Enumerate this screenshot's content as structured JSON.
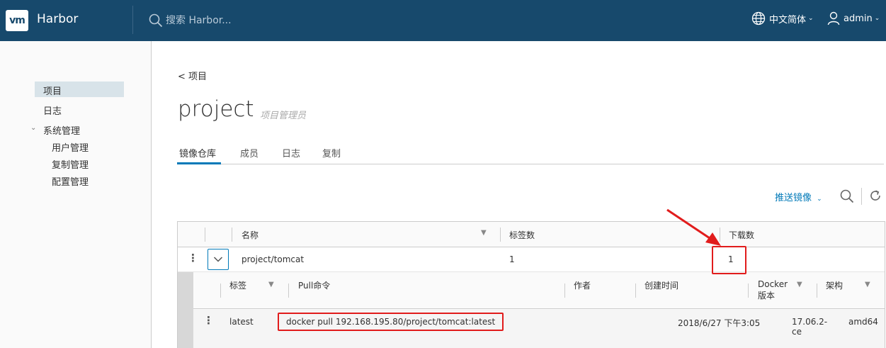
{
  "header": {
    "logo_text": "vm",
    "brand": "Harbor",
    "search_placeholder": "搜索 Harbor...",
    "language": "中文简体",
    "user": "admin"
  },
  "sidebar": {
    "items": [
      {
        "label": "项目",
        "active": true
      },
      {
        "label": "日志"
      },
      {
        "label": "系统管理",
        "children": [
          "用户管理",
          "复制管理",
          "配置管理"
        ]
      }
    ]
  },
  "main": {
    "back_link": "< 项目",
    "title": "project",
    "role": "项目管理员",
    "tabs": [
      "镜像仓库",
      "成员",
      "日志",
      "复制"
    ],
    "push_button": "推送镜像"
  },
  "repo_table": {
    "columns": [
      "名称",
      "标签数",
      "下载数"
    ],
    "rows": [
      {
        "name": "project/tomcat",
        "tags": "1",
        "pulls": "1"
      }
    ]
  },
  "tag_table": {
    "columns": [
      "标签",
      "Pull命令",
      "作者",
      "创建时间",
      "Docker",
      "版本",
      "架构"
    ],
    "rows": [
      {
        "tag": "latest",
        "pull_command": "docker pull 192.168.195.80/project/tomcat:latest",
        "author": "",
        "created": "2018/6/27 下午3:05",
        "docker_version_1": "17.06.2-",
        "docker_version_2": "ce",
        "arch": "amd64"
      }
    ]
  },
  "colors": {
    "header_bg": "#17496c",
    "accent": "#0079b8",
    "annotation_red": "#e11c1c"
  }
}
